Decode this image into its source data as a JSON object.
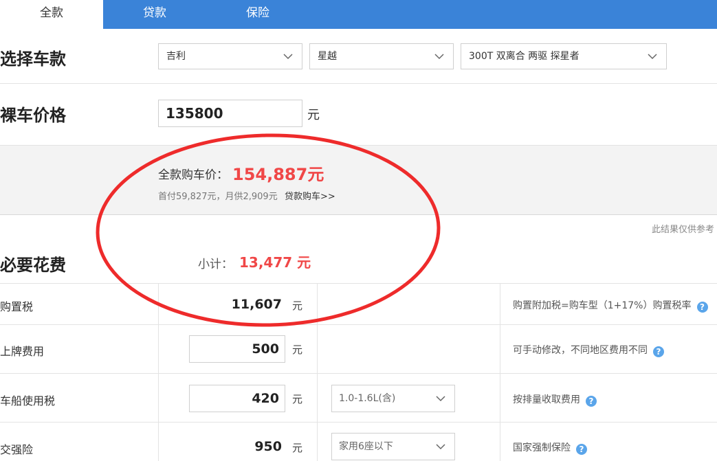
{
  "tabs": [
    {
      "label": "全款",
      "active": true
    },
    {
      "label": "贷款",
      "active": false
    },
    {
      "label": "保险",
      "active": false
    }
  ],
  "select_car": {
    "label": "选择车款",
    "brand": "吉利",
    "series": "星越",
    "model": "300T 双离合 两驱 探星者"
  },
  "bare_price": {
    "label": "裸车价格",
    "value": "135800",
    "unit": "元"
  },
  "summary": {
    "label": "全款购车价：",
    "value": "154,887元",
    "loan_info": "首付59,827元，月供2,909元",
    "loan_link": "贷款购车>>"
  },
  "disclaimer": "此结果仅供参考",
  "required_fees": {
    "label": "必要花费",
    "subtotal_label": "小计：",
    "subtotal_value": "13,477 元",
    "rows": [
      {
        "name": "购置税",
        "value": "11,607",
        "unit": "元",
        "note": "购置附加税=购车型（1+17%）购置税率"
      },
      {
        "name": "上牌费用",
        "value": "500",
        "unit": "元",
        "note": "可手动修改，不同地区费用不同"
      },
      {
        "name": "车船使用税",
        "value": "420",
        "unit": "元",
        "option": "1.0-1.6L(含)",
        "note": "按排量收取费用"
      },
      {
        "name": "交强险",
        "value": "950",
        "unit": "元",
        "option": "家用6座以下",
        "note": "国家强制保险"
      }
    ]
  },
  "colors": {
    "tab_bar": "#3a83d8",
    "highlight_red": "#f04747",
    "annotation_red": "#ee2b2b",
    "help_icon": "#5aa5ea"
  },
  "icons": {
    "dropdown": "chevron-down-icon",
    "help": "question-circle-icon"
  },
  "help_glyph": "?"
}
